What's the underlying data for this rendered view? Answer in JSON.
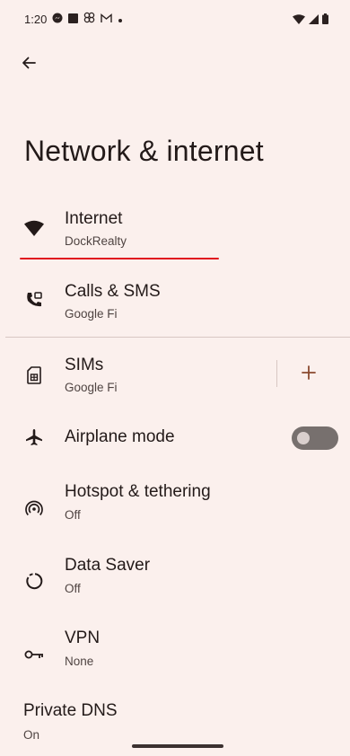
{
  "status_bar": {
    "time": "1:20",
    "left_icons": [
      "messenger-icon",
      "square-notification-icon",
      "pinwheel-icon",
      "gmail-icon",
      "dot-icon"
    ],
    "right_icons": [
      "wifi-icon",
      "signal-icon",
      "battery-icon"
    ]
  },
  "header": {
    "back_icon": "back-arrow-icon",
    "title": "Network & internet"
  },
  "items": {
    "internet": {
      "title": "Internet",
      "subtitle": "DockRealty",
      "icon": "wifi-icon"
    },
    "calls": {
      "title": "Calls & SMS",
      "subtitle": "Google Fi",
      "icon": "phone-sms-icon"
    },
    "sims": {
      "title": "SIMs",
      "subtitle": "Google Fi",
      "icon": "sim-card-icon",
      "action_icon": "add-icon"
    },
    "airplane": {
      "title": "Airplane mode",
      "icon": "airplane-icon",
      "toggle_on": false
    },
    "hotspot": {
      "title": "Hotspot & tethering",
      "subtitle": "Off",
      "icon": "hotspot-icon"
    },
    "data_saver": {
      "title": "Data Saver",
      "subtitle": "Off",
      "icon": "data-saver-icon"
    },
    "vpn": {
      "title": "VPN",
      "subtitle": "None",
      "icon": "vpn-key-icon"
    },
    "private_dns": {
      "title": "Private DNS",
      "subtitle": "On"
    }
  },
  "colors": {
    "background": "#fbf0ed",
    "text_primary": "#231a19",
    "text_secondary": "#4f4442",
    "underline_mark": "#e0141e",
    "accent": "#8a4a2f",
    "toggle_track_off": "#77706e"
  }
}
